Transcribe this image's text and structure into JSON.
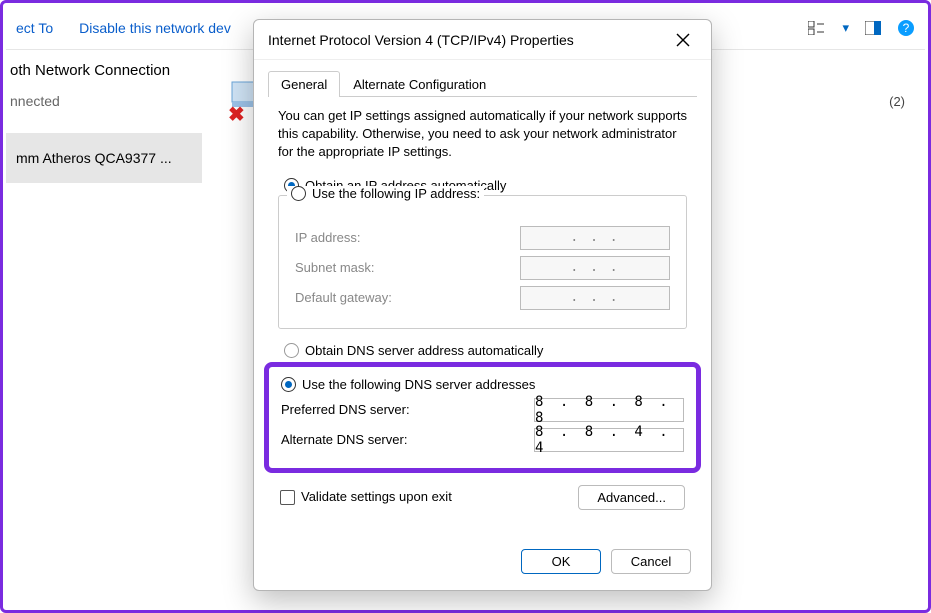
{
  "bg": {
    "toolbar": {
      "connect_to": "ect To",
      "disable_device": "Disable this network dev"
    },
    "connection_label": "oth Network Connection",
    "status": "nnected",
    "adapter_card": "mm Atheros QCA9377 ...",
    "right_extra": "(2)"
  },
  "dialog": {
    "title": "Internet Protocol Version 4 (TCP/IPv4) Properties",
    "tabs": {
      "general": "General",
      "alt": "Alternate Configuration"
    },
    "intro": "You can get IP settings assigned automatically if your network supports this capability. Otherwise, you need to ask your network administrator for the appropriate IP settings.",
    "ip": {
      "auto": "Obtain an IP address automatically",
      "manual": "Use the following IP address:",
      "ip_label": "IP address:",
      "subnet_label": "Subnet mask:",
      "gateway_label": "Default gateway:",
      "ip_val": ".     .     .",
      "subnet_val": ".     .     .",
      "gateway_val": ".     .     ."
    },
    "dns": {
      "auto": "Obtain DNS server address automatically",
      "manual": "Use the following DNS server addresses",
      "preferred_label": "Preferred DNS server:",
      "alternate_label": "Alternate DNS server:",
      "preferred_val": "8 . 8 . 8 . 8",
      "alternate_val": "8 . 8 . 4 . 4"
    },
    "validate": "Validate settings upon exit",
    "advanced": "Advanced...",
    "ok": "OK",
    "cancel": "Cancel"
  }
}
